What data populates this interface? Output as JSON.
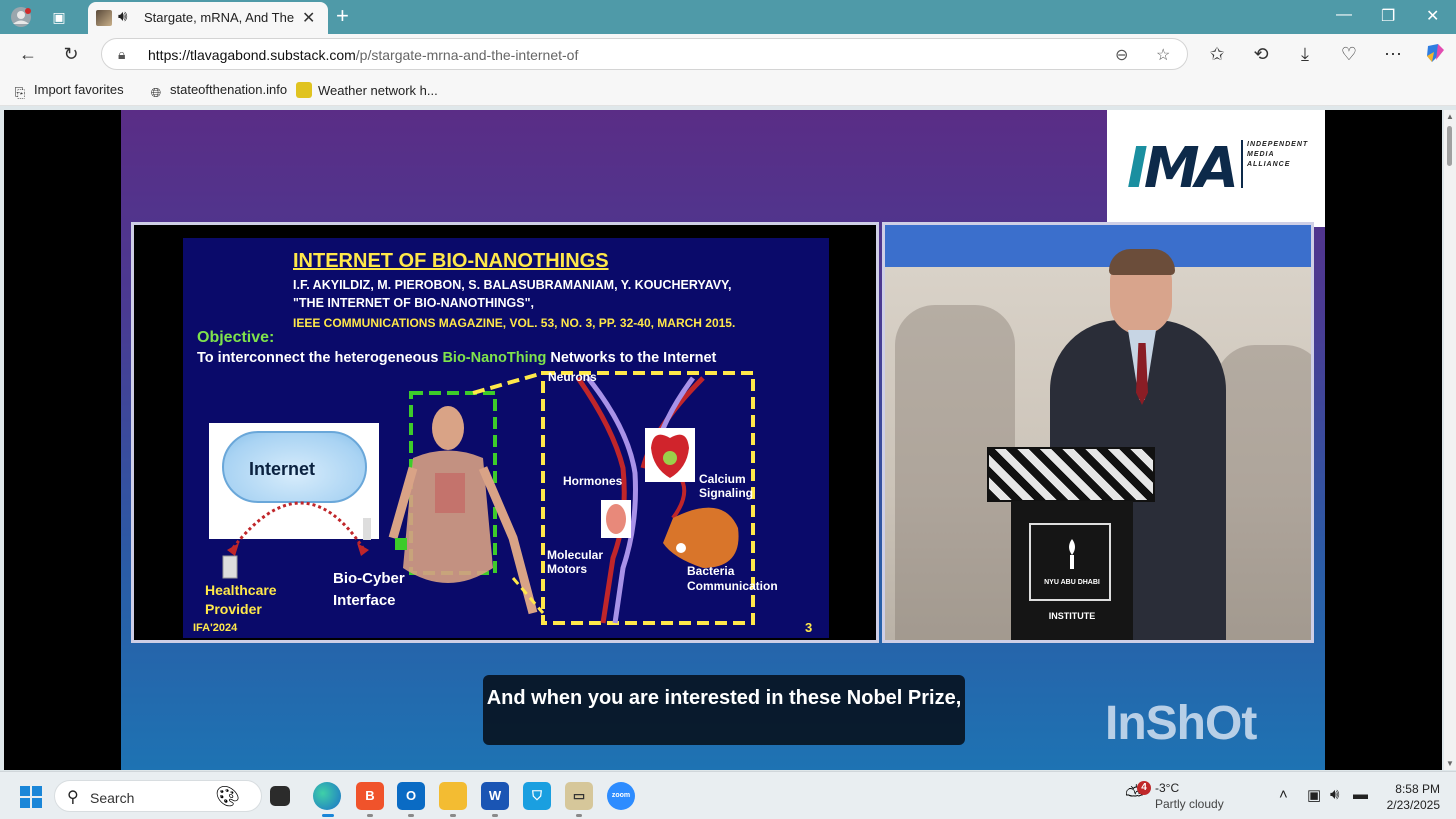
{
  "browser": {
    "tab_title": "Stargate, mRNA, And The Int",
    "url_domain": "https://tlavagabond.substack.com",
    "url_path": "/p/stargate-mrna-and-the-internet-of",
    "favorites": [
      {
        "label": "Import favorites",
        "icon": "folder-import-icon"
      },
      {
        "label": "stateofthenation.info",
        "icon": "globe-icon"
      },
      {
        "label": "Weather network h...",
        "icon": "weather-icon"
      }
    ]
  },
  "video": {
    "logo_letters": "IMA",
    "logo_text": [
      "INDEPENDENT",
      "MEDIA",
      "ALLIANCE"
    ],
    "watermark": "InShOt",
    "caption": "And when you are interested in these Nobel Prize,",
    "slide": {
      "title": "INTERNET OF BIO-NANOTHINGS",
      "authors": "I.F. AKYILDIZ, M. PIEROBON, S. BALASUBRAMANIAM, Y. KOUCHERYAVY,",
      "paper": "\"THE INTERNET OF BIO-NANOTHINGS\",",
      "journal": "IEEE COMMUNICATIONS MAGAZINE, VOL. 53, NO. 3, PP. 32-40, MARCH 2015.",
      "objective_label": "Objective:",
      "objective_pre": "To interconnect the heterogeneous ",
      "objective_highlight": "Bio-NanoThing",
      "objective_post": " Networks to the Internet",
      "internet_label": "Internet",
      "healthcare_label": "Healthcare Provider",
      "biocyber_label": "Bio-Cyber Interface",
      "neurons_label": "Neurons",
      "hormones_label": "Hormones",
      "calcium_label": "Calcium Signaling",
      "molecular_label": "Molecular Motors",
      "bacteria_label": "Bacteria Communication",
      "footer": "IFA'2024",
      "page_number": "3"
    },
    "speaker": {
      "podium_text": "NYU ABU DHABI",
      "podium_label": "INSTITUTE"
    }
  },
  "taskbar": {
    "search_label": "Search",
    "weather_badge": "4",
    "weather_temp": "-3°C",
    "weather_condition": "Partly cloudy",
    "time": "8:58 PM",
    "date": "2/23/2025"
  }
}
